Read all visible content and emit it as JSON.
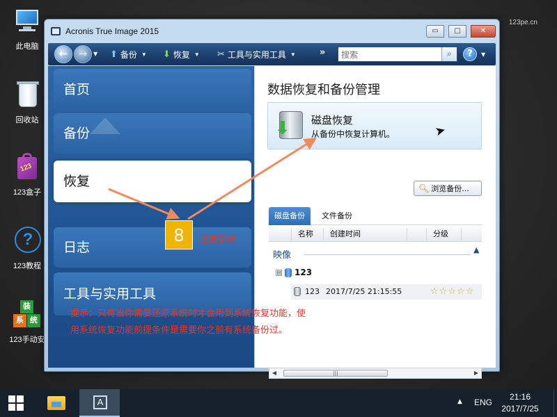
{
  "watermark": "123pe.cn",
  "desktop_icons": [
    {
      "label": "此电脑",
      "icon": "computer-icon"
    },
    {
      "label": "回收站",
      "icon": "recycle-bin-icon"
    },
    {
      "label": "123盒子",
      "icon": "123-box-icon",
      "digits": "123"
    },
    {
      "label": "123教程",
      "icon": "help-icon",
      "glyph": "?"
    },
    {
      "label": "123手动安",
      "icon": "manual-install-icon",
      "tiles": [
        "装",
        "系",
        "统"
      ]
    }
  ],
  "window": {
    "title": "Acronis True Image 2015",
    "controls": {
      "minimize": "▭",
      "maximize": "□",
      "close": "✕"
    }
  },
  "toolbar": {
    "back": "←",
    "forward": "→",
    "backup_label": "备份",
    "recover_label": "恢复",
    "tools_label": "工具与实用工具",
    "more": "»",
    "search_placeholder": "搜索",
    "help": "?"
  },
  "sidebar": {
    "items": [
      {
        "label": "首页",
        "active": false
      },
      {
        "label": "备份",
        "active": false
      },
      {
        "label": "恢复",
        "active": true
      },
      {
        "label": "日志",
        "active": false
      },
      {
        "label": "工具与实用工具",
        "active": false
      }
    ]
  },
  "content": {
    "title": "数据恢复和备份管理",
    "card": {
      "title": "磁盘恢复",
      "subtitle": "从备份中恢复计算机。"
    },
    "browse_button": "浏览备份...",
    "tabs": [
      {
        "label": "磁盘备份",
        "active": true
      },
      {
        "label": "文件备份",
        "active": false
      }
    ],
    "columns": [
      "名称",
      "创建时间",
      "分级"
    ],
    "section": "映像",
    "tree": {
      "expander": "⊟",
      "node": "123"
    },
    "rows": [
      {
        "name": "123",
        "created": "2017/7/25 21:15:55",
        "stars": "☆☆☆☆☆"
      }
    ],
    "scroll_grip": "|||"
  },
  "annotation": {
    "step": "8",
    "label": "还原系统",
    "hint_line1": "提示：只有当你需要还原系统时才会用到系统恢复功能，使",
    "hint_line2": "用系统恢复功能前提条件是需要你之前有系统备份过。",
    "color": "#e8352a"
  },
  "taskbar": {
    "acronis_letter": "A",
    "language": "ENG",
    "time": "21:16",
    "date": "2017/7/25"
  }
}
